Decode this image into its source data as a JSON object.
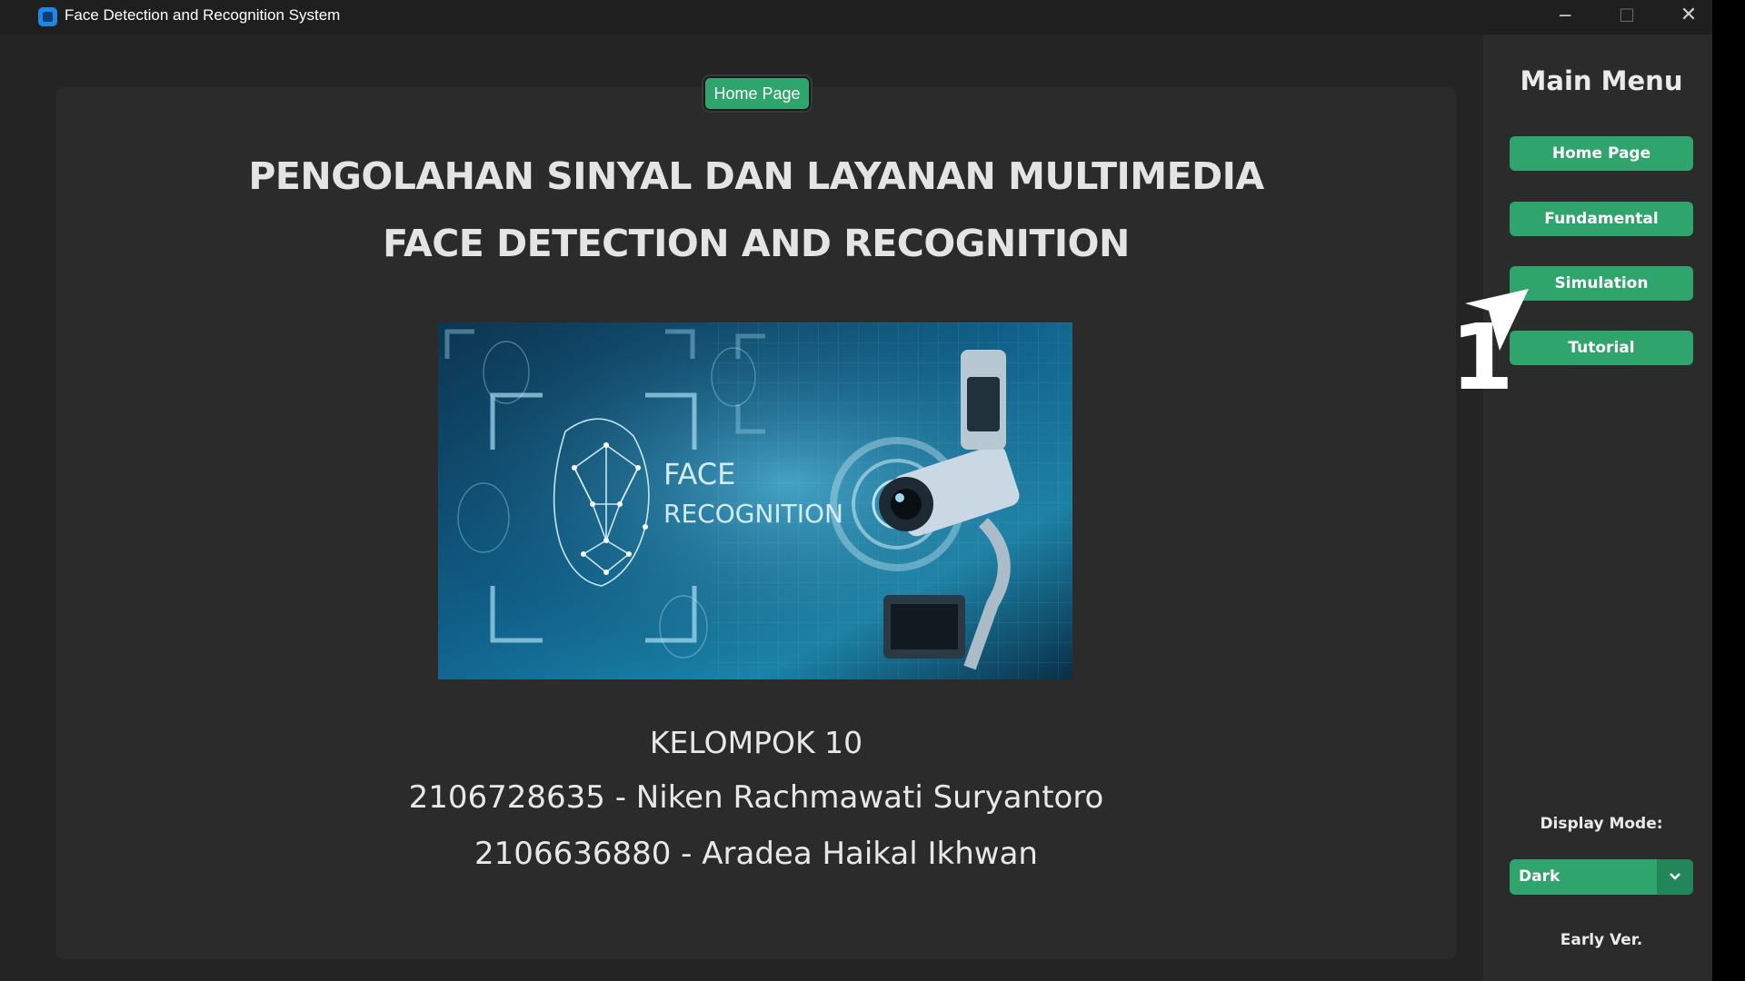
{
  "window": {
    "title": "Face Detection and Recognition System",
    "controls": {
      "minimize": "─",
      "maximize": "☐",
      "close": "✕"
    }
  },
  "main": {
    "page_badge": "Home Page",
    "headline_1": "PENGOLAHAN SINYAL DAN LAYANAN MULTIMEDIA",
    "headline_2": "FACE DETECTION AND RECOGNITION",
    "hero_image": {
      "caption_line1": "FACE",
      "caption_line2": "RECOGNITION",
      "icon": "face-recognition-cctv-illustration"
    },
    "group": "KELOMPOK 10",
    "members": [
      "2106728635 - Niken Rachmawati Suryantoro",
      "2106636880 - Aradea Haikal Ikhwan"
    ]
  },
  "sidebar": {
    "title": "Main Menu",
    "items": [
      {
        "label": "Home Page"
      },
      {
        "label": "Fundamental"
      },
      {
        "label": "Simulation"
      },
      {
        "label": "Tutorial"
      }
    ],
    "display_mode_label": "Display Mode:",
    "display_mode_value": "Dark",
    "version": "Early Ver."
  },
  "annotation": {
    "number": "1"
  },
  "colors": {
    "accent": "#2fa46c",
    "background": "#242424",
    "panel": "#2b2b2b"
  }
}
